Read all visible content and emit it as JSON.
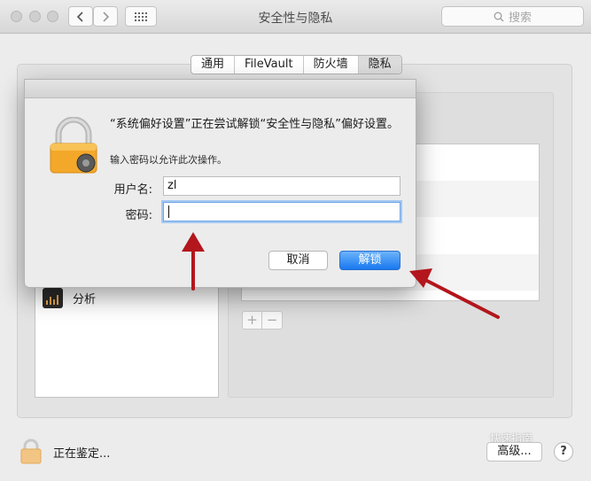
{
  "window": {
    "title": "安全性与隐私",
    "search_placeholder": "搜索"
  },
  "tabs": [
    {
      "label": "通用",
      "active": false
    },
    {
      "label": "FileVault",
      "active": false
    },
    {
      "label": "防火墙",
      "active": false
    },
    {
      "label": "隐私",
      "active": true
    }
  ],
  "sidebar": {
    "items": [
      {
        "label": "分析",
        "icon": "analytics-icon"
      }
    ]
  },
  "dialog": {
    "title": "“系统偏好设置”正在尝试解锁“安全性与隐私”偏好设置。",
    "subtitle": "输入密码以允许此次操作。",
    "username_label": "用户名:",
    "username_value": "zl",
    "password_label": "密码:",
    "password_value": "",
    "cancel_label": "取消",
    "unlock_label": "解锁"
  },
  "footer": {
    "status_text": "正在鉴定...",
    "advanced_label": "高级...",
    "help_label": "?"
  },
  "watermark": "快速指南",
  "colors": {
    "accent": "#1878ef",
    "annotation_arrow": "#b3161c",
    "lock_gold": "#f0a623"
  }
}
